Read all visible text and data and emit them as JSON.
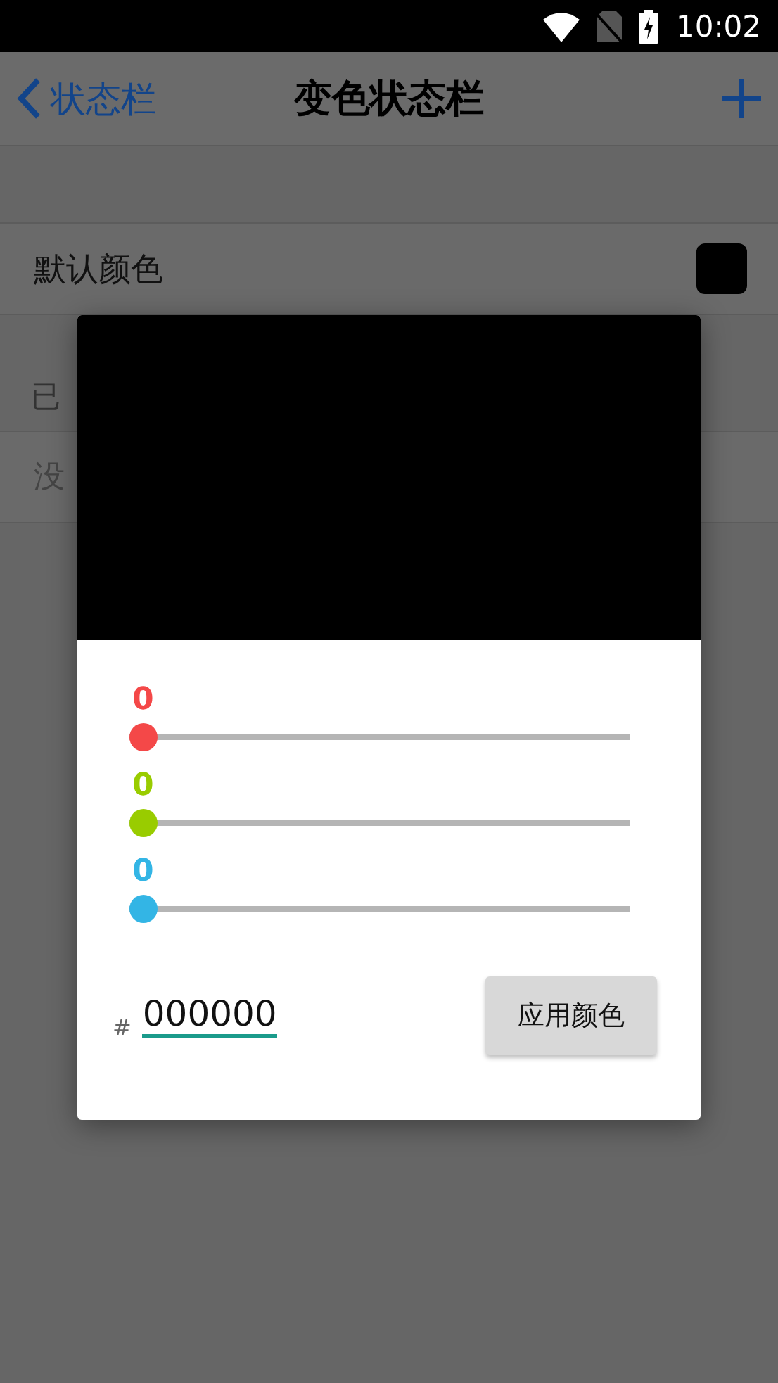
{
  "status_bar": {
    "time": "10:02"
  },
  "nav": {
    "back_label": "状态栏",
    "title": "变色状态栏"
  },
  "default_color": {
    "label": "默认颜色"
  },
  "custom_section": {
    "header": "已",
    "empty_text": "没"
  },
  "dialog": {
    "channels": [
      {
        "value": "0",
        "level": 0,
        "color": "#f44848"
      },
      {
        "value": "0",
        "level": 0,
        "color": "#99cc00"
      },
      {
        "value": "0",
        "level": 0,
        "color": "#33b5e5"
      }
    ],
    "hex": {
      "prefix": "#",
      "value": "000000"
    },
    "apply_button": "应用颜色"
  }
}
